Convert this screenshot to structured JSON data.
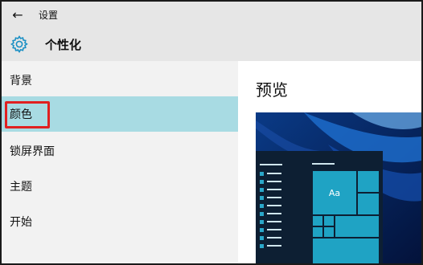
{
  "titlebar": {
    "back_icon": "arrow-left-icon",
    "app_title": "设置"
  },
  "header": {
    "icon": "gear-icon",
    "title": "个性化"
  },
  "sidebar": {
    "items": [
      {
        "label": "背景",
        "active": false
      },
      {
        "label": "颜色",
        "active": true
      },
      {
        "label": "锁屏界面",
        "active": false
      },
      {
        "label": "主题",
        "active": false
      },
      {
        "label": "开始",
        "active": false
      }
    ]
  },
  "main": {
    "preview_title": "预览",
    "preview": {
      "tile_label": "Aa"
    }
  },
  "colors": {
    "accent": "#1fa3c4",
    "selected_item": "#a8dbe3",
    "highlight_box": "#e02020",
    "start_menu_bg": "#0d1f33"
  }
}
